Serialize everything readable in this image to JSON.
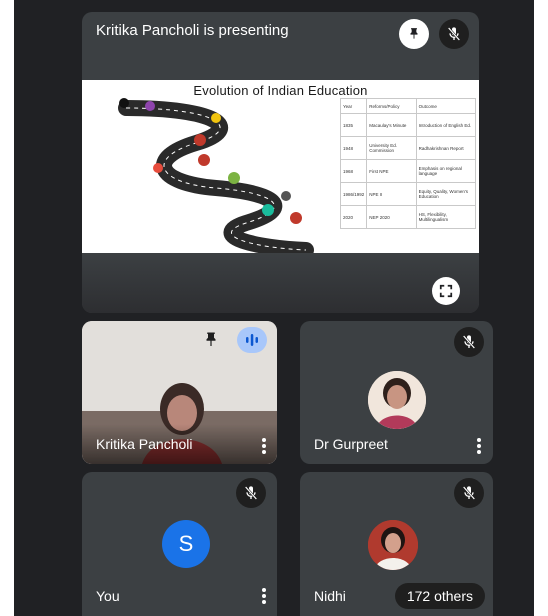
{
  "presentation": {
    "title": "Kritika Pancholi is presenting",
    "pin_icon": "pin-icon",
    "mic_icon": "mic-off-icon",
    "fullscreen_icon": "fullscreen-icon",
    "slide": {
      "title": "Evolution of Indian Education",
      "table": {
        "headers": [
          "Year",
          "Reforms/Policy",
          "Outcome"
        ],
        "rows": [
          [
            "1835",
            "Macaulay's Minute",
            "Introduction of English Ed."
          ],
          [
            "1948",
            "University Ed. Commission",
            "Radhakrishnan Report"
          ],
          [
            "1968",
            "First NPE",
            "Emphasis on regional language"
          ],
          [
            "1986/1992",
            "NPE II",
            "Equity, Quality, Women's Education"
          ],
          [
            "2020",
            "NEP 2020",
            "HS, Flexibility, Multilingualism"
          ]
        ]
      }
    }
  },
  "participants": [
    {
      "name": "Kritika Pancholi",
      "mic": "speaking",
      "icon": "pin-icon"
    },
    {
      "name": "Dr Gurpreet",
      "mic": "muted"
    },
    {
      "name": "You",
      "mic": "muted",
      "initial": "S",
      "avatar_color": "#1a73e8"
    },
    {
      "name": "Nidhi",
      "mic": "muted",
      "others": "172 others"
    }
  ],
  "colors": {
    "background": "#202124",
    "tile": "#3c4043",
    "speaking": "#a8c7fa",
    "avatar_you": "#1a73e8"
  }
}
